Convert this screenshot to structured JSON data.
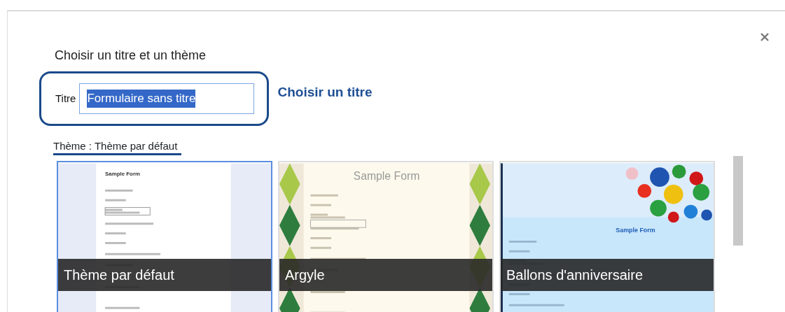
{
  "dialog": {
    "heading": "Choisir un titre et un thème"
  },
  "title_field": {
    "label": "Titre",
    "value": "Formulaire sans titre",
    "value_selected": true
  },
  "annotation": "Choisir un titre",
  "theme_label": "Thème : Thème par défaut",
  "themes": [
    {
      "kind": "default",
      "preview_title": "Sample Form",
      "name": "Thème par défaut",
      "selected": true
    },
    {
      "kind": "argyle",
      "preview_title": "Sample Form",
      "name": "Argyle",
      "selected": false
    },
    {
      "kind": "balloons",
      "preview_title": "Sample Form",
      "name": "Ballons d'anniversaire",
      "selected": false
    }
  ]
}
